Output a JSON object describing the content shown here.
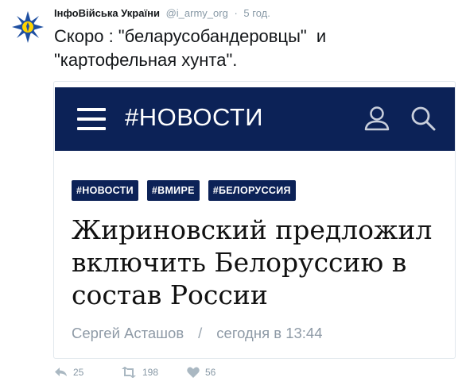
{
  "tweet": {
    "author_name": "ІнфоВійська України",
    "handle": "@i_army_org",
    "separator": "·",
    "time": "5 год.",
    "text": "Скоро : \"беларусобандеровцы\"  и\n\"картофельная хунта\".",
    "avatar_icon": "shield-emblem-icon"
  },
  "card": {
    "nav_title": "#НОВОСТИ",
    "tags": [
      "#НОВОСТИ",
      "#ВМИРЕ",
      "#БЕЛОРУССИЯ"
    ],
    "headline": "Жириновский предложил включить Белоруссию в состав России",
    "author": "Сергей Асташов",
    "slash": "/",
    "date": "сегодня в 13:44",
    "colors": {
      "nav_bg": "#0c2257",
      "tag_bg": "#0c2257"
    }
  },
  "actions": {
    "reply_count": "25",
    "retweet_count": "198",
    "like_count": "56"
  }
}
